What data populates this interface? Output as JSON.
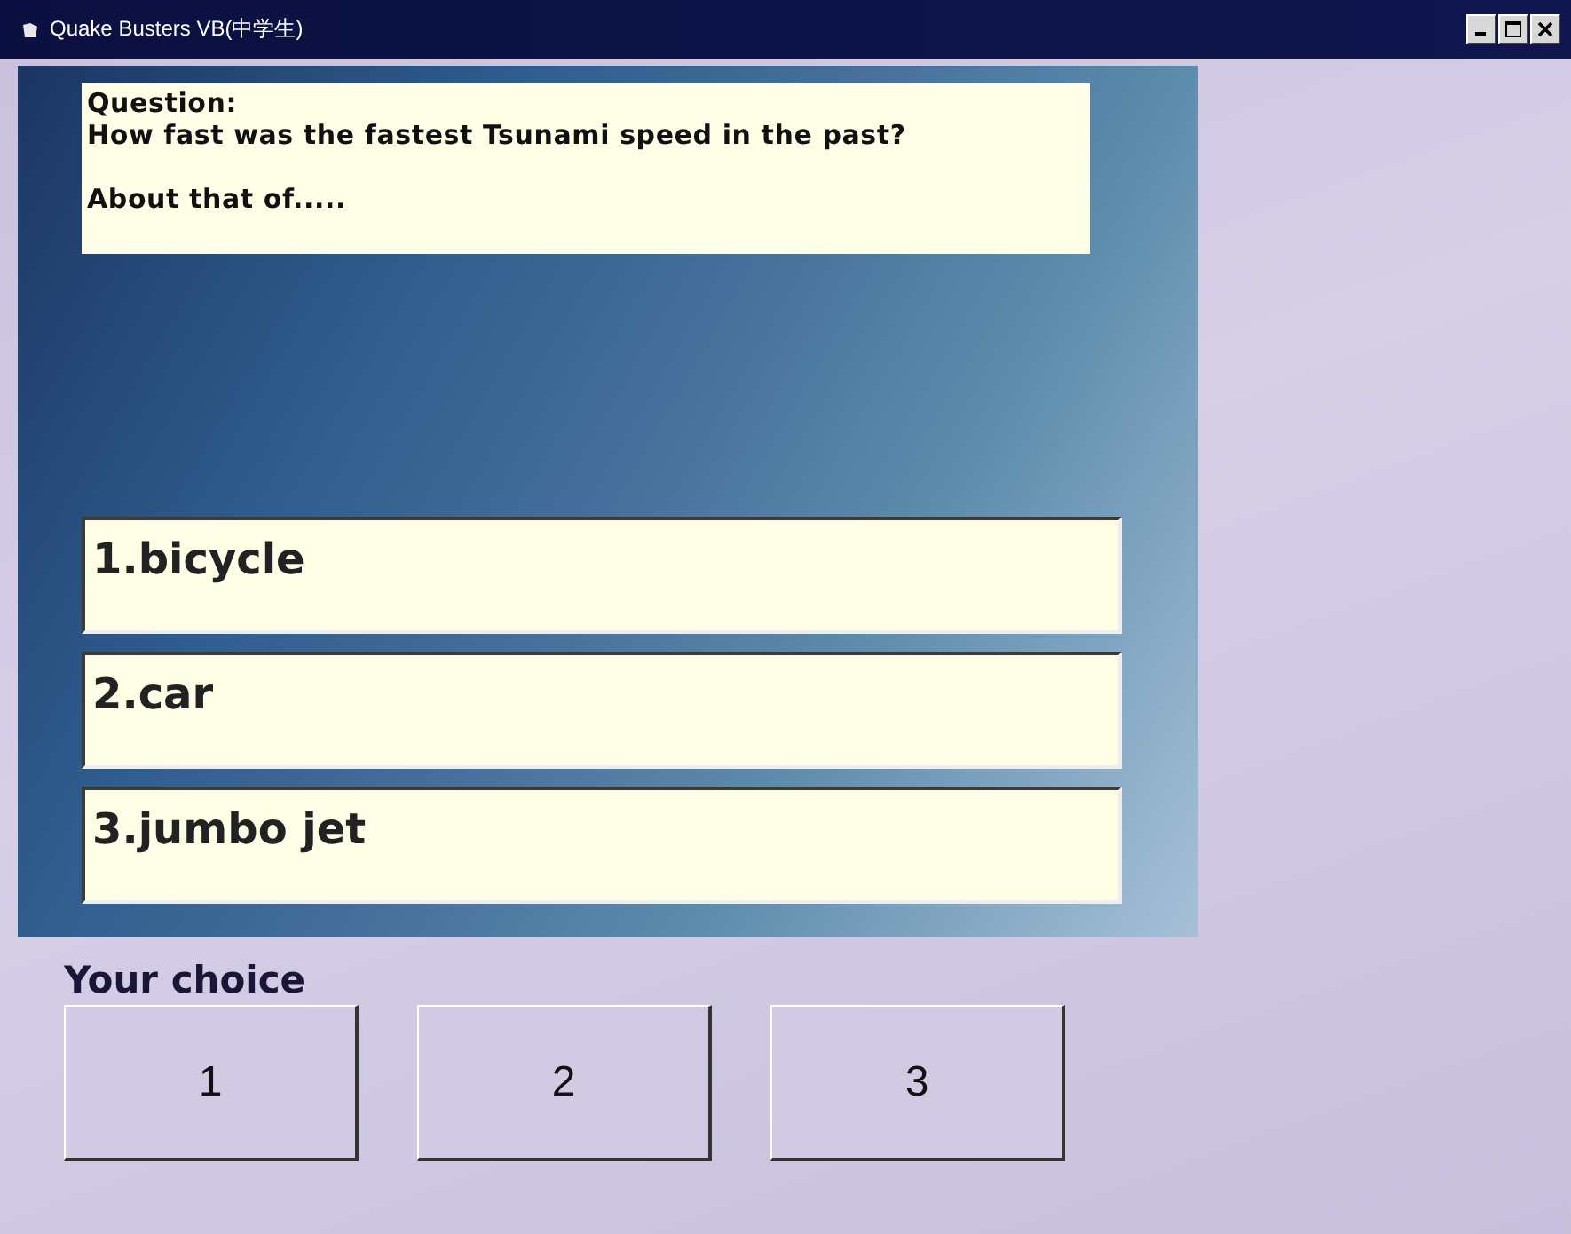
{
  "window": {
    "title": "Quake Busters VB(中学生)"
  },
  "question": {
    "heading": "Question:",
    "text": "How fast was the fastest Tsunami speed in the past?",
    "lead_in": "About that of....."
  },
  "options": [
    {
      "label": "1.bicycle"
    },
    {
      "label": "2.car"
    },
    {
      "label": "3.jumbo jet"
    }
  ],
  "choice": {
    "label": "Your choice",
    "buttons": [
      "1",
      "2",
      "3"
    ]
  }
}
